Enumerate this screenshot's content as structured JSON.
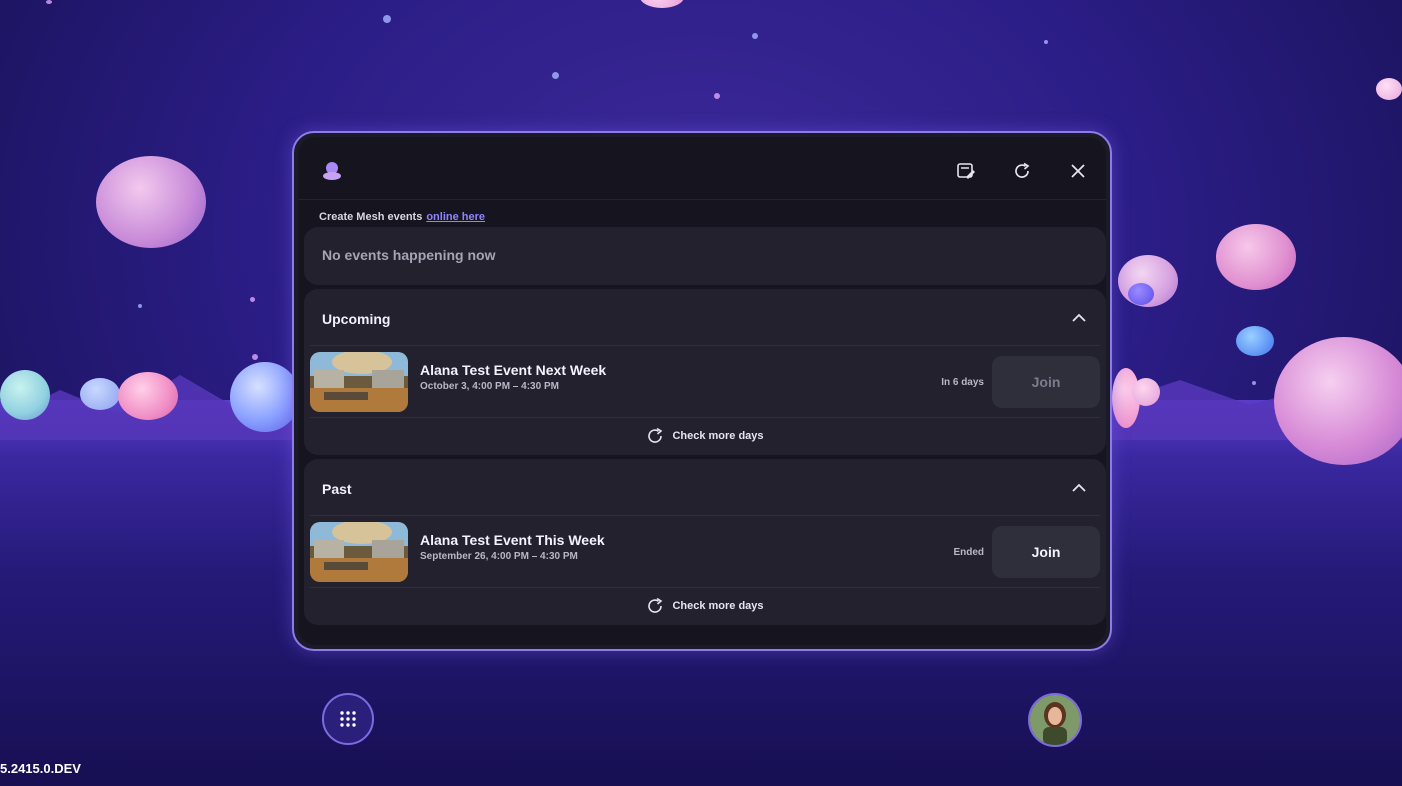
{
  "panel": {
    "create_text": "Create Mesh events",
    "create_link": "online here",
    "no_events_now": "No events happening now"
  },
  "sections": {
    "upcoming": {
      "title": "Upcoming",
      "event": {
        "title": "Alana Test Event Next Week",
        "date": "October 3, 4:00 PM – 4:30 PM",
        "status": "In 6 days",
        "join_label": "Join"
      },
      "more_label": "Check more days"
    },
    "past": {
      "title": "Past",
      "event": {
        "title": "Alana Test Event This Week",
        "date": "September 26, 4:00 PM – 4:30 PM",
        "status": "Ended",
        "join_label": "Join"
      },
      "more_label": "Check more days"
    }
  },
  "version": "5.2415.0.DEV",
  "icons": {
    "logo": "mesh-logo-icon",
    "edit": "edit-note-icon",
    "refresh": "refresh-icon",
    "close": "close-icon",
    "apps": "apps-grid-icon",
    "avatar": "avatar"
  },
  "colors": {
    "accent": "#8f84ff",
    "panel_border": "#8f7be8",
    "panel_bg": "#16151f",
    "card_bg": "#22212d"
  }
}
